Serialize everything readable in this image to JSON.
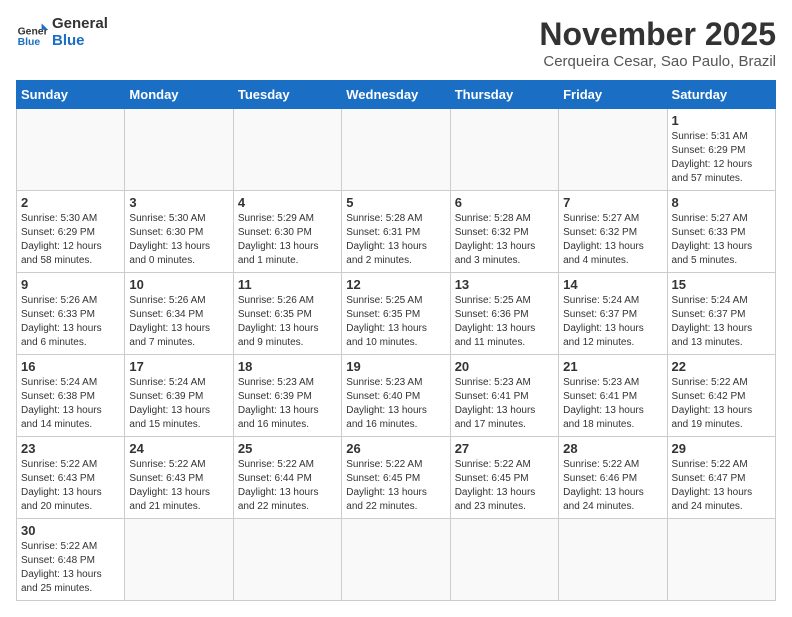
{
  "header": {
    "logo_general": "General",
    "logo_blue": "Blue",
    "month": "November 2025",
    "location": "Cerqueira Cesar, Sao Paulo, Brazil"
  },
  "weekdays": [
    "Sunday",
    "Monday",
    "Tuesday",
    "Wednesday",
    "Thursday",
    "Friday",
    "Saturday"
  ],
  "days": {
    "1": {
      "sunrise": "5:31 AM",
      "sunset": "6:29 PM",
      "daylight": "12 hours and 57 minutes."
    },
    "2": {
      "sunrise": "5:30 AM",
      "sunset": "6:29 PM",
      "daylight": "12 hours and 58 minutes."
    },
    "3": {
      "sunrise": "5:30 AM",
      "sunset": "6:30 PM",
      "daylight": "13 hours and 0 minutes."
    },
    "4": {
      "sunrise": "5:29 AM",
      "sunset": "6:30 PM",
      "daylight": "13 hours and 1 minute."
    },
    "5": {
      "sunrise": "5:28 AM",
      "sunset": "6:31 PM",
      "daylight": "13 hours and 2 minutes."
    },
    "6": {
      "sunrise": "5:28 AM",
      "sunset": "6:32 PM",
      "daylight": "13 hours and 3 minutes."
    },
    "7": {
      "sunrise": "5:27 AM",
      "sunset": "6:32 PM",
      "daylight": "13 hours and 4 minutes."
    },
    "8": {
      "sunrise": "5:27 AM",
      "sunset": "6:33 PM",
      "daylight": "13 hours and 5 minutes."
    },
    "9": {
      "sunrise": "5:26 AM",
      "sunset": "6:33 PM",
      "daylight": "13 hours and 6 minutes."
    },
    "10": {
      "sunrise": "5:26 AM",
      "sunset": "6:34 PM",
      "daylight": "13 hours and 7 minutes."
    },
    "11": {
      "sunrise": "5:26 AM",
      "sunset": "6:35 PM",
      "daylight": "13 hours and 9 minutes."
    },
    "12": {
      "sunrise": "5:25 AM",
      "sunset": "6:35 PM",
      "daylight": "13 hours and 10 minutes."
    },
    "13": {
      "sunrise": "5:25 AM",
      "sunset": "6:36 PM",
      "daylight": "13 hours and 11 minutes."
    },
    "14": {
      "sunrise": "5:24 AM",
      "sunset": "6:37 PM",
      "daylight": "13 hours and 12 minutes."
    },
    "15": {
      "sunrise": "5:24 AM",
      "sunset": "6:37 PM",
      "daylight": "13 hours and 13 minutes."
    },
    "16": {
      "sunrise": "5:24 AM",
      "sunset": "6:38 PM",
      "daylight": "13 hours and 14 minutes."
    },
    "17": {
      "sunrise": "5:24 AM",
      "sunset": "6:39 PM",
      "daylight": "13 hours and 15 minutes."
    },
    "18": {
      "sunrise": "5:23 AM",
      "sunset": "6:39 PM",
      "daylight": "13 hours and 16 minutes."
    },
    "19": {
      "sunrise": "5:23 AM",
      "sunset": "6:40 PM",
      "daylight": "13 hours and 16 minutes."
    },
    "20": {
      "sunrise": "5:23 AM",
      "sunset": "6:41 PM",
      "daylight": "13 hours and 17 minutes."
    },
    "21": {
      "sunrise": "5:23 AM",
      "sunset": "6:41 PM",
      "daylight": "13 hours and 18 minutes."
    },
    "22": {
      "sunrise": "5:22 AM",
      "sunset": "6:42 PM",
      "daylight": "13 hours and 19 minutes."
    },
    "23": {
      "sunrise": "5:22 AM",
      "sunset": "6:43 PM",
      "daylight": "13 hours and 20 minutes."
    },
    "24": {
      "sunrise": "5:22 AM",
      "sunset": "6:43 PM",
      "daylight": "13 hours and 21 minutes."
    },
    "25": {
      "sunrise": "5:22 AM",
      "sunset": "6:44 PM",
      "daylight": "13 hours and 22 minutes."
    },
    "26": {
      "sunrise": "5:22 AM",
      "sunset": "6:45 PM",
      "daylight": "13 hours and 22 minutes."
    },
    "27": {
      "sunrise": "5:22 AM",
      "sunset": "6:45 PM",
      "daylight": "13 hours and 23 minutes."
    },
    "28": {
      "sunrise": "5:22 AM",
      "sunset": "6:46 PM",
      "daylight": "13 hours and 24 minutes."
    },
    "29": {
      "sunrise": "5:22 AM",
      "sunset": "6:47 PM",
      "daylight": "13 hours and 24 minutes."
    },
    "30": {
      "sunrise": "5:22 AM",
      "sunset": "6:48 PM",
      "daylight": "13 hours and 25 minutes."
    }
  },
  "labels": {
    "sunrise": "Sunrise:",
    "sunset": "Sunset:",
    "daylight": "Daylight:"
  }
}
